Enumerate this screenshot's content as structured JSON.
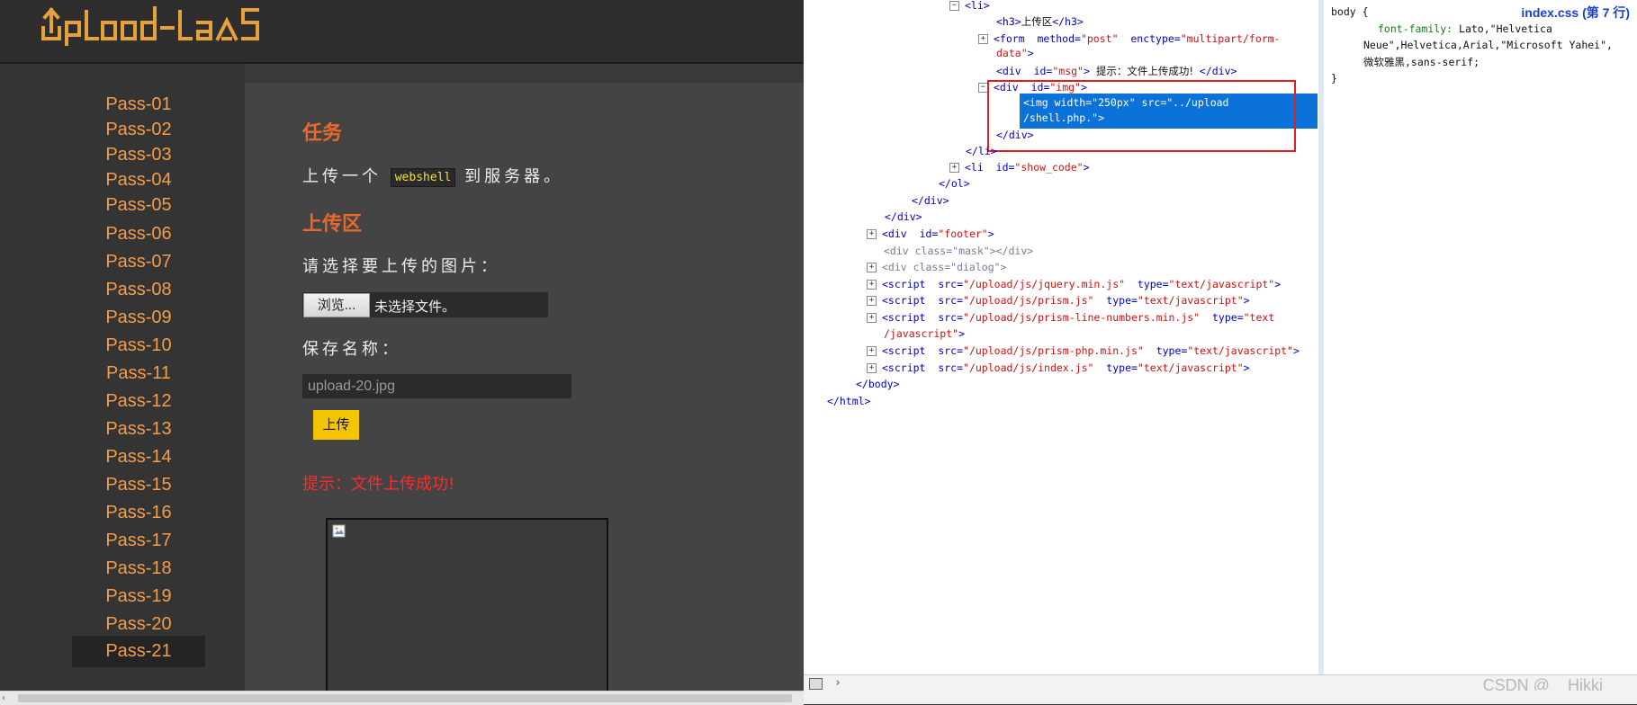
{
  "page": {
    "logo_text": "UpLoad-labS",
    "sidebar": {
      "items": [
        "Pass-01",
        "Pass-02",
        "Pass-03",
        "Pass-04",
        "Pass-05",
        "Pass-06",
        "Pass-07",
        "Pass-08",
        "Pass-09",
        "Pass-10",
        "Pass-11",
        "Pass-12",
        "Pass-13",
        "Pass-14",
        "Pass-15",
        "Pass-16",
        "Pass-17",
        "Pass-18",
        "Pass-19",
        "Pass-20",
        "Pass-21"
      ],
      "active": "Pass-21"
    },
    "task": {
      "title": "任务",
      "text_before": "上传一个",
      "code": "webshell",
      "text_after": "到服务器。"
    },
    "upload": {
      "title": "上传区",
      "choose_label": "请选择要上传的图片：",
      "browse_label": "浏览...",
      "file_status": "未选择文件。",
      "save_label": "保存名称：",
      "save_value": "upload-20.jpg",
      "submit_label": "上传",
      "message": "提示：文件上传成功!"
    },
    "colors": {
      "accent": "#e8692b",
      "pass_link": "#f39c4a",
      "upload_button": "#f5c400",
      "message": "#ff2a2a",
      "selection": "#0a72d8",
      "highlight_frame": "#e02020"
    }
  },
  "devtools": {
    "tree": {
      "li_open": "<li>",
      "h3_tag_open": "<h3>",
      "h3_text": "上传区",
      "h3_tag_close": "</h3>",
      "form_tag": "<form",
      "form_attr1_name": "method=",
      "form_attr1_value": "\"post\"",
      "form_attr2_name": "enctype=",
      "form_attr2_value_a": "\"multipart/form-",
      "form_attr2_value_b": "data\"",
      "form_close": ">",
      "msg_tag": "<div",
      "msg_attr_name": "id=",
      "msg_attr_value": "\"msg\"",
      "msg_gt": ">",
      "msg_text": "提示：文件上传成功!",
      "msg_close": "</div>",
      "img_div_tag": "<div",
      "img_div_attr_name": "id=",
      "img_div_attr_value": "\"img\"",
      "img_div_gt": ">",
      "selected_line1": "<img  width=\"250px\"  src=\"../upload",
      "selected_line2": "/shell.php.\">",
      "div_close": "</div>",
      "li_close": "</li>",
      "li_show_tag": "<li",
      "li_show_attr_name": "id=",
      "li_show_attr_value": "\"show_code\"",
      "li_show_gt": ">",
      "ol_close": "</ol>",
      "div_close2": "</div>",
      "div_close3": "</div>",
      "footer_tag": "<div",
      "footer_attr_name": "id=",
      "footer_attr_value": "\"footer\"",
      "footer_gt": ">",
      "mask_line": "<div  class=\"mask\"></div>",
      "dialog_line": "<div  class=\"dialog\">",
      "script1_src": "\"/upload/js/jquery.min.js\"",
      "script2_src": "\"/upload/js/prism.js\"",
      "script3_src": "\"/upload/js/prism-line-numbers.min.js\"",
      "script3_type_a": "\"text",
      "script3_type_b": "/javascript\"",
      "script4_src": "\"/upload/js/prism-php.min.js\"",
      "script5_src": "\"/upload/js/index.js\"",
      "script_type": "\"text/javascript\"",
      "script_tag": "<script",
      "src_attr": "src=",
      "type_attr": "type=",
      "body_close": "</body>",
      "html_close": "</html>"
    },
    "css": {
      "selector": "body {",
      "prop": "font-family:",
      "value1": "Lato,\"Helvetica",
      "value2": "Neue\",Helvetica,Arial,\"Microsoft Yahei\",",
      "value3": "微软雅黑,sans-serif;",
      "close": "}",
      "source": "index.css (第 7 行)"
    },
    "console_prompt": "›"
  },
  "watermark": "CSDN @__Hikki__",
  "scroll_left_arrow": "‹"
}
